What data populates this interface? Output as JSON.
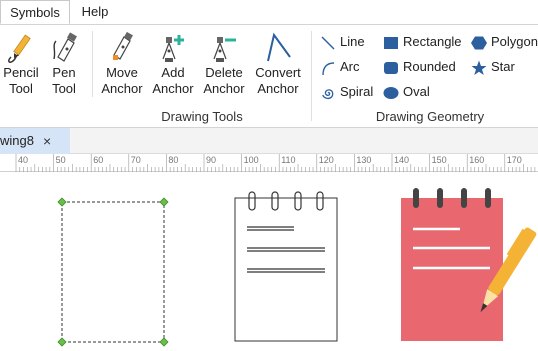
{
  "menubar": {
    "tabs": [
      {
        "label": "Symbols"
      },
      {
        "label": "Help"
      }
    ]
  },
  "ribbon": {
    "drawing_tools": {
      "buttons": [
        {
          "label": "Pencil\nTool",
          "icon": "pencil-icon"
        },
        {
          "label": "Pen\nTool",
          "icon": "pen-tool-icon"
        },
        {
          "label": "Move\nAnchor",
          "icon": "move-anchor-icon"
        },
        {
          "label": "Add\nAnchor",
          "icon": "add-anchor-icon"
        },
        {
          "label": "Delete\nAnchor",
          "icon": "delete-anchor-icon"
        },
        {
          "label": "Convert\nAnchor",
          "icon": "convert-anchor-icon"
        }
      ],
      "group_label": "Drawing Tools"
    },
    "drawing_geometry": {
      "items": [
        {
          "label": "Line",
          "icon": "line-icon"
        },
        {
          "label": "Arc",
          "icon": "arc-icon"
        },
        {
          "label": "Spiral",
          "icon": "spiral-icon"
        },
        {
          "label": "Rectangle",
          "icon": "rectangle-icon"
        },
        {
          "label": "Rounded",
          "icon": "rounded-rectangle-icon"
        },
        {
          "label": "Oval",
          "icon": "oval-icon"
        },
        {
          "label": "Polygon",
          "icon": "polygon-icon"
        },
        {
          "label": "Star",
          "icon": "star-icon"
        }
      ],
      "group_label": "Drawing Geometry"
    }
  },
  "tabbar": {
    "document_tab": "wing8",
    "close_symbol": "×"
  },
  "ruler": {
    "ticks": [
      "40",
      "50",
      "60",
      "70",
      "80",
      "90",
      "100",
      "110",
      "120",
      "130",
      "140",
      "150",
      "160",
      "170"
    ]
  },
  "colors": {
    "accent": "#2c5f9e",
    "anchor_green": "#6abf4b",
    "notepad_red": "#e9686f",
    "pen_yellow": "#f5b335"
  }
}
